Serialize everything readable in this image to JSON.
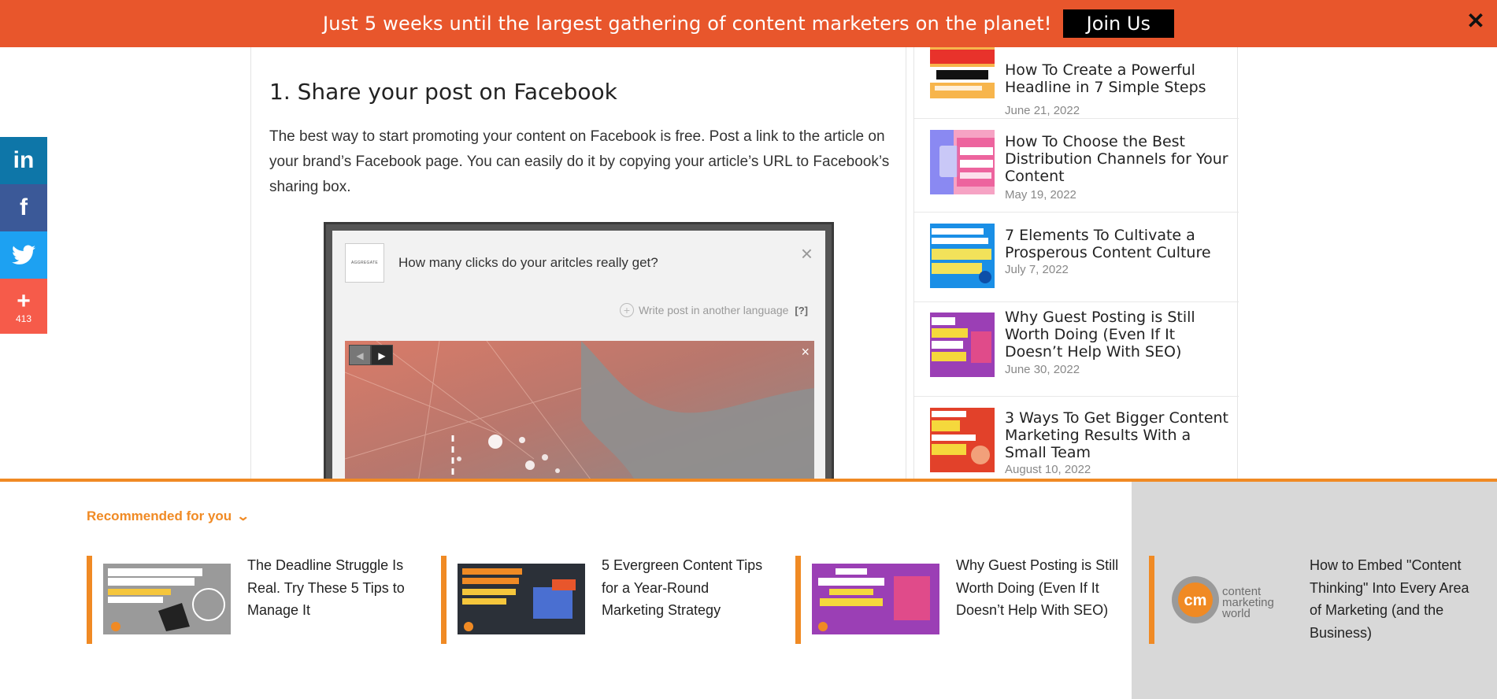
{
  "promo": {
    "message": "Just 5 weeks until the largest gathering of content marketers on the planet!",
    "button": "Join Us",
    "close_icon": "✕"
  },
  "article": {
    "heading": "1. Share your post on Facebook",
    "paragraph": "The best way to start promoting your content on Facebook is free. Post a link to the article on your brand’s Facebook page. You can easily do it by copying your article’s URL to Facebook’s sharing box.",
    "fb_mock": {
      "logo_text": "AGGREGATE",
      "question": "How many clicks do your aritcles really get?",
      "lang_link": "Write post in another language",
      "lang_help": "[?]"
    }
  },
  "social": {
    "linkedin": "in",
    "facebook": "f",
    "more_count": "413"
  },
  "sidebar": {
    "posts": [
      {
        "title": "How To Create a Powerful Headline in 7 Simple Steps",
        "date": "June 21, 2022"
      },
      {
        "title": "How To Choose the Best Distribution Channels for Your Content",
        "date": "May 19, 2022"
      },
      {
        "title": "7 Elements To Cultivate a Prosperous Content Culture",
        "date": "July 7, 2022"
      },
      {
        "title": "Why Guest Posting is Still Worth Doing (Even If It Doesn’t Help With SEO)",
        "date": "June 30, 2022"
      },
      {
        "title": "3 Ways To Get Bigger Content Marketing Results With a Small Team",
        "date": "August 10, 2022"
      }
    ]
  },
  "recommended": {
    "heading": "Recommended for you",
    "items": [
      {
        "title": "The Deadline Struggle Is Real. Try These 5 Tips to Manage It"
      },
      {
        "title": "5 Evergreen Content Tips for a Year-Round Marketing Strategy"
      },
      {
        "title": "Why Guest Posting is Still Worth Doing (Even If It Doesn’t Help With SEO)"
      },
      {
        "title": "How to Embed \"Content Thinking\" Into Every Area of Marketing (and the Business)"
      }
    ],
    "cmw_logo": {
      "line1": "content",
      "line2": "marketing",
      "line3": "world"
    }
  },
  "colors": {
    "banner": "#e8562c",
    "accent": "#f08a24"
  }
}
